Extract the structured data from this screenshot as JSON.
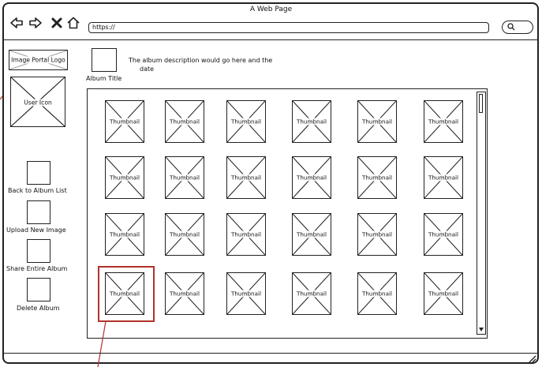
{
  "browser": {
    "title": "A Web Page",
    "url": "https://"
  },
  "sidebar": {
    "logo_label": "Image Portal Logo",
    "user_icon_label": "User Icon",
    "actions": [
      {
        "label": "Back to Album List"
      },
      {
        "label": "Upload New Image"
      },
      {
        "label": "Share Entire Album"
      },
      {
        "label": "Delete Album"
      }
    ]
  },
  "album": {
    "title": "Album Title",
    "description_line1": "The album description would go here and the",
    "description_line2": "date"
  },
  "thumbnails": [
    {
      "label": "Thumbnail"
    },
    {
      "label": "Thumbnail"
    },
    {
      "label": "Thumbnail"
    },
    {
      "label": "Thumbnail"
    },
    {
      "label": "Thumbnail"
    },
    {
      "label": "Thumbnail"
    },
    {
      "label": "Thumbnail"
    },
    {
      "label": "Thumbnail"
    },
    {
      "label": "Thumbnail"
    },
    {
      "label": "Thumbnail"
    },
    {
      "label": "Thumbnail"
    },
    {
      "label": "Thumbnail"
    },
    {
      "label": "Thumbnail"
    },
    {
      "label": "Thumbnail"
    },
    {
      "label": "Thumbnail"
    },
    {
      "label": "Thumbnail"
    },
    {
      "label": "Thumbnail"
    },
    {
      "label": "Thumbnail"
    },
    {
      "label": "Thumbnail"
    },
    {
      "label": "Thumbnail"
    },
    {
      "label": "Thumbnail"
    },
    {
      "label": "Thumbnail"
    },
    {
      "label": "Thumbnail"
    },
    {
      "label": "Thumbnail"
    }
  ],
  "colors": {
    "line": "#222222",
    "annotation": "#b0322a"
  }
}
